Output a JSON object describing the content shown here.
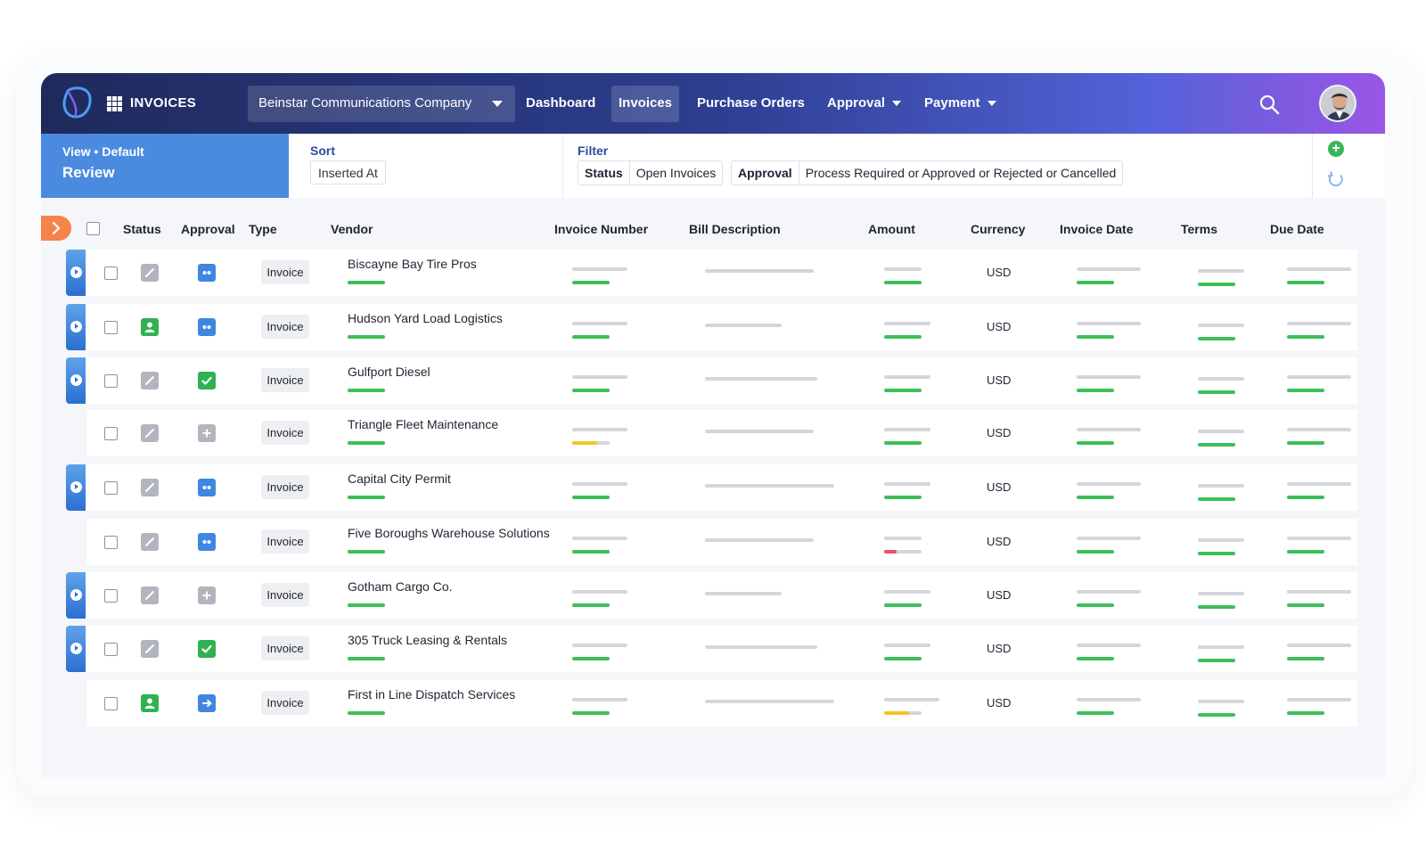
{
  "app": {
    "title": "INVOICES"
  },
  "header": {
    "company": "Beinstar Communications Company",
    "nav": [
      {
        "label": "Dashboard",
        "active": false,
        "dropdown": false
      },
      {
        "label": "Invoices",
        "active": true,
        "dropdown": false
      },
      {
        "label": "Purchase Orders",
        "active": false,
        "dropdown": false
      },
      {
        "label": "Approval",
        "active": false,
        "dropdown": true
      },
      {
        "label": "Payment",
        "active": false,
        "dropdown": true
      }
    ]
  },
  "view": {
    "label": "View • Default",
    "name": "Review"
  },
  "sort": {
    "label": "Sort",
    "value": "Inserted At"
  },
  "filter": {
    "label": "Filter",
    "chips": [
      {
        "key": "Status",
        "value": "Open Invoices"
      },
      {
        "key": "Approval",
        "value": "Process Required or Approved or Rejected or Cancelled"
      }
    ]
  },
  "table": {
    "columns": [
      "Status",
      "Approval",
      "Type",
      "Vendor",
      "Invoice Number",
      "Bill Description",
      "Amount",
      "Currency",
      "Invoice Date",
      "Terms",
      "Due Date"
    ],
    "rows": [
      {
        "flag": true,
        "status_icon": "edit-icon",
        "approval_icon": "dots-icon",
        "type": "Invoice",
        "vendor": "Biscayne Bay Tire Pros",
        "currency": "USD",
        "invoice_progress_color": "#3cbf5a",
        "amount_progress_color": "#3cbf5a"
      },
      {
        "flag": true,
        "status_icon": "person-icon",
        "approval_icon": "dots-icon",
        "type": "Invoice",
        "vendor": "Hudson Yard Load Logistics",
        "currency": "USD",
        "invoice_progress_color": "#3cbf5a",
        "amount_progress_color": "#3cbf5a"
      },
      {
        "flag": true,
        "status_icon": "edit-icon",
        "approval_icon": "check-icon",
        "type": "Invoice",
        "vendor": "Gulfport Diesel",
        "currency": "USD",
        "invoice_progress_color": "#3cbf5a",
        "amount_progress_color": "#3cbf5a"
      },
      {
        "flag": false,
        "status_icon": "edit-icon",
        "approval_icon": "plus-icon",
        "type": "Invoice",
        "vendor": "Triangle Fleet Maintenance",
        "currency": "USD",
        "invoice_progress_color": "#f5c428",
        "amount_progress_color": "#3cbf5a"
      },
      {
        "flag": true,
        "status_icon": "edit-icon",
        "approval_icon": "dots-icon",
        "type": "Invoice",
        "vendor": "Capital City Permit",
        "currency": "USD",
        "invoice_progress_color": "#3cbf5a",
        "amount_progress_color": "#3cbf5a"
      },
      {
        "flag": false,
        "status_icon": "edit-icon",
        "approval_icon": "dots-icon",
        "type": "Invoice",
        "vendor": "Five Boroughs Warehouse Solutions",
        "currency": "USD",
        "invoice_progress_color": "#3cbf5a",
        "amount_progress_color": "#f14b6e"
      },
      {
        "flag": true,
        "status_icon": "edit-icon",
        "approval_icon": "plus-icon",
        "type": "Invoice",
        "vendor": "Gotham Cargo Co.",
        "currency": "USD",
        "invoice_progress_color": "#3cbf5a",
        "amount_progress_color": "#3cbf5a"
      },
      {
        "flag": true,
        "status_icon": "edit-icon",
        "approval_icon": "check-icon",
        "type": "Invoice",
        "vendor": "305 Truck Leasing & Rentals",
        "currency": "USD",
        "invoice_progress_color": "#3cbf5a",
        "amount_progress_color": "#3cbf5a"
      },
      {
        "flag": false,
        "status_icon": "person-icon",
        "approval_icon": "arrow-icon",
        "type": "Invoice",
        "vendor": "First in Line Dispatch Services",
        "currency": "USD",
        "invoice_progress_color": "#3cbf5a",
        "amount_progress_color": "#f5c428"
      }
    ]
  },
  "colors": {
    "accent": "#4a8be0",
    "header_start": "#1f2a5c",
    "header_end": "#9a56e6",
    "collapse_tab": "#f5834a",
    "success": "#3cbf5a"
  }
}
